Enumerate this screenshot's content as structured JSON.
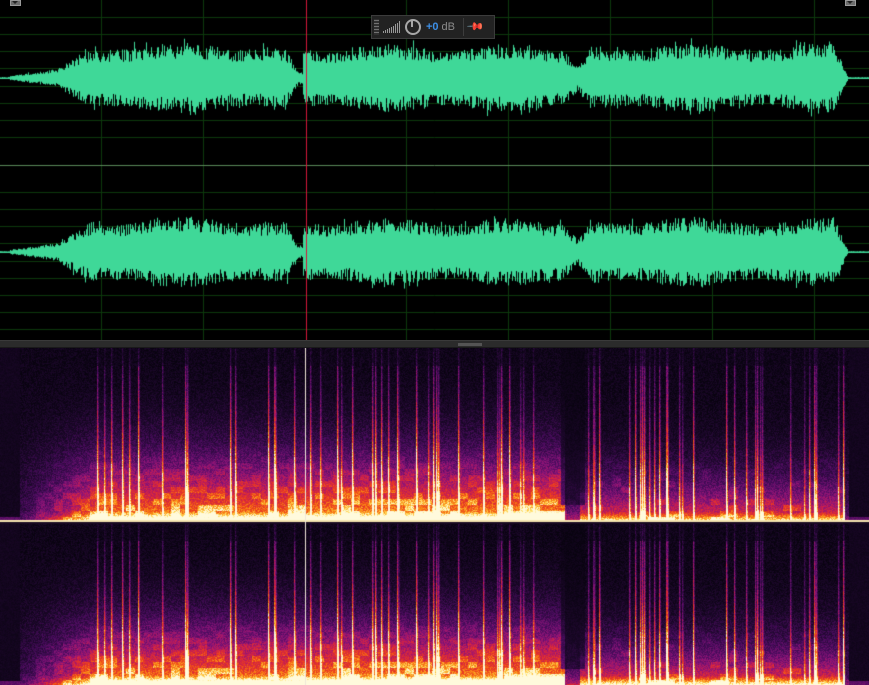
{
  "hud": {
    "gain_value": "+0",
    "gain_unit": "dB",
    "pin_glyph": "📌"
  },
  "colors": {
    "waveform": "#3fd898",
    "gridline": "#0c3a0c",
    "centerline": "#5a8a5a",
    "playhead": "#d4173a",
    "gain_accent": "#3d8fe6"
  },
  "icons": [
    "volume-bars-icon",
    "gain-knob-icon",
    "pin-icon",
    "drag-handle-icon",
    "splitter-grip-icon"
  ]
}
